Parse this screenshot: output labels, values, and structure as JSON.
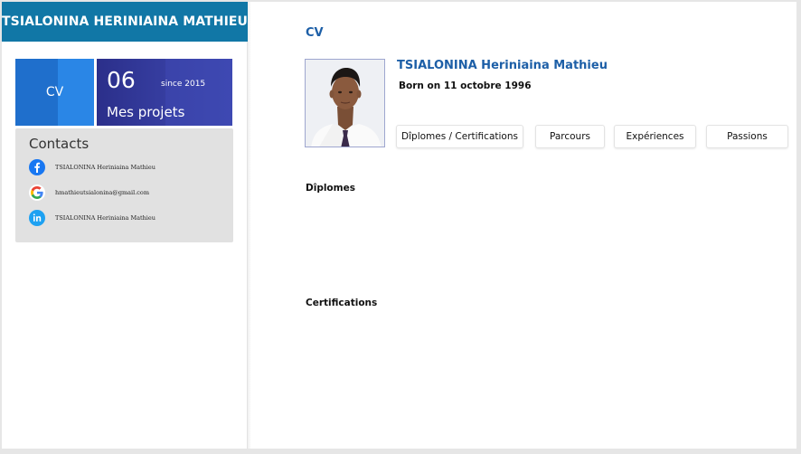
{
  "sidebar": {
    "owner_name": "TSIALONINA HERINIAINA MATHIEU",
    "tile_cv": {
      "label": "CV"
    },
    "tile_projects": {
      "number": "06",
      "since": "since 2015",
      "title": "Mes projets"
    },
    "contacts": {
      "heading": "Contacts",
      "items": [
        {
          "icon": "facebook-icon",
          "text": "TSIALONINA Heriniaina Mathieu"
        },
        {
          "icon": "google-icon",
          "text": "hmathieutsialonina@gmail.com"
        },
        {
          "icon": "linkedin-icon",
          "text": "TSIALONINA Heriniaina Mathieu"
        }
      ]
    }
  },
  "main": {
    "section_title": "CV",
    "profile": {
      "name": "TSIALONINA Heriniaina Mathieu",
      "born": "Born on 11 octobre 1996"
    },
    "tabs": [
      {
        "label": "Dîplomes / Certifications"
      },
      {
        "label": "Parcours"
      },
      {
        "label": "Expériences"
      },
      {
        "label": "Passions"
      }
    ],
    "sections": {
      "diplomes": "Dîplomes",
      "certifications": "Certifications"
    }
  },
  "colors": {
    "header_bar": "#1177a6",
    "accent_blue": "#1d5fa7",
    "tile_cv": "#2a86e6",
    "tile_projects": "#353c9e",
    "contacts_bg": "#e1e1e1"
  }
}
